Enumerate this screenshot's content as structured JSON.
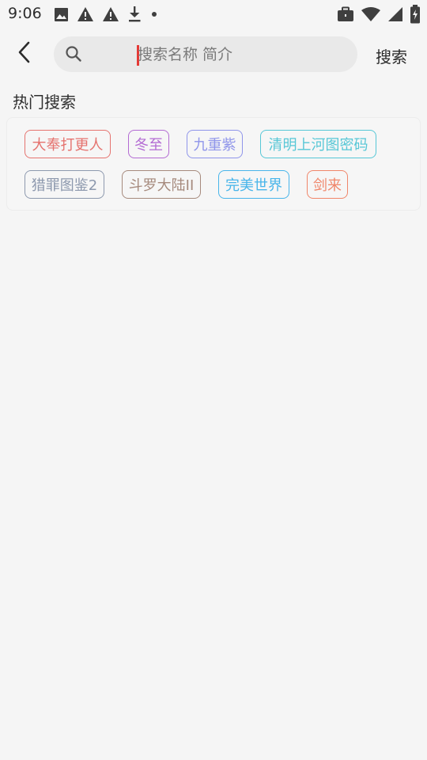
{
  "status_bar": {
    "time": "9:06",
    "left_icons": [
      "image-icon",
      "warning-icon",
      "warning-icon",
      "download-icon",
      "dot-icon"
    ],
    "right_icons": [
      "briefcase-icon",
      "wifi-icon",
      "signal-icon",
      "battery-icon"
    ]
  },
  "header": {
    "back_icon": "chevron-left-icon",
    "search_placeholder": "搜索名称 简介",
    "search_value": "",
    "search_button": "搜索"
  },
  "hot_search": {
    "title": "热门搜索",
    "tags": [
      {
        "label": "大奉打更人",
        "color": "#e5736f"
      },
      {
        "label": "冬至",
        "color": "#b36bd3"
      },
      {
        "label": "九重紫",
        "color": "#8f95ea"
      },
      {
        "label": "清明上河图密码",
        "color": "#57c7d6"
      },
      {
        "label": "猎罪图鉴2",
        "color": "#8d99ae"
      },
      {
        "label": "斗罗大陆II",
        "color": "#a68a7d"
      },
      {
        "label": "完美世界",
        "color": "#48b5ea"
      },
      {
        "label": "剑来",
        "color": "#f0866a"
      }
    ]
  }
}
